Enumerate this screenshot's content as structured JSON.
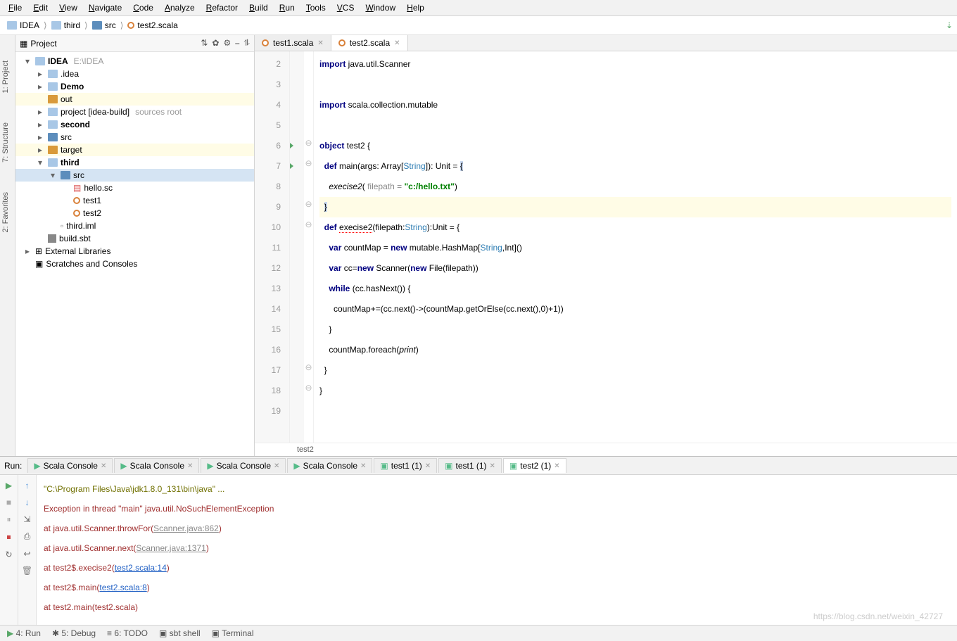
{
  "menu": [
    "File",
    "Edit",
    "View",
    "Navigate",
    "Code",
    "Analyze",
    "Refactor",
    "Build",
    "Run",
    "Tools",
    "VCS",
    "Window",
    "Help"
  ],
  "breadcrumbs": [
    {
      "icon": "idea",
      "label": "IDEA"
    },
    {
      "icon": "folder",
      "label": "third"
    },
    {
      "icon": "folder-blue",
      "label": "src"
    },
    {
      "icon": "scala",
      "label": "test2.scala"
    }
  ],
  "left_tabs": [
    "1: Project",
    "7: Structure",
    "2: Favorites"
  ],
  "project_panel": {
    "title": "Project",
    "tools": [
      "⇅",
      "✿",
      "⚙",
      "⎯",
      "⥮"
    ]
  },
  "tree": [
    {
      "d": 0,
      "tw": "▾",
      "ico": "idea",
      "label": "IDEA",
      "suffix": "E:\\IDEA",
      "bold": true
    },
    {
      "d": 1,
      "tw": "▸",
      "ico": "folder",
      "label": ".idea"
    },
    {
      "d": 1,
      "tw": "▸",
      "ico": "folder",
      "label": "Demo",
      "bold": true
    },
    {
      "d": 1,
      "tw": "",
      "ico": "folder-orange",
      "label": "out",
      "hl": true
    },
    {
      "d": 1,
      "tw": "▸",
      "ico": "folder",
      "label": "project [idea-build]",
      "suffix": "sources root"
    },
    {
      "d": 1,
      "tw": "▸",
      "ico": "folder",
      "label": "second",
      "bold": true
    },
    {
      "d": 1,
      "tw": "▸",
      "ico": "folder-blue",
      "label": "src"
    },
    {
      "d": 1,
      "tw": "▸",
      "ico": "folder-orange",
      "label": "target",
      "hl": true
    },
    {
      "d": 1,
      "tw": "▾",
      "ico": "folder",
      "label": "third",
      "bold": true
    },
    {
      "d": 2,
      "tw": "▾",
      "ico": "folder-blue",
      "label": "src",
      "sel": true
    },
    {
      "d": 3,
      "tw": "",
      "ico": "scala-file",
      "label": "hello.sc"
    },
    {
      "d": 3,
      "tw": "",
      "ico": "scala",
      "label": "test1"
    },
    {
      "d": 3,
      "tw": "",
      "ico": "scala",
      "label": "test2"
    },
    {
      "d": 2,
      "tw": "",
      "ico": "file",
      "label": "third.iml"
    },
    {
      "d": 1,
      "tw": "",
      "ico": "sbt",
      "label": "build.sbt"
    },
    {
      "d": 0,
      "tw": "▸",
      "ico": "lib",
      "label": "External Libraries"
    },
    {
      "d": 0,
      "tw": "",
      "ico": "scratch",
      "label": "Scratches and Consoles"
    }
  ],
  "editor_tabs": [
    {
      "label": "test1.scala",
      "active": false
    },
    {
      "label": "test2.scala",
      "active": true
    }
  ],
  "code_lines": [
    {
      "n": 2,
      "html": "<span class='kw'>import</span> java.util.Scanner"
    },
    {
      "n": 3,
      "html": ""
    },
    {
      "n": 4,
      "html": "<span class='kw'>import</span> scala.collection.mutable"
    },
    {
      "n": 5,
      "html": ""
    },
    {
      "n": 6,
      "run": true,
      "fold": "⊖",
      "html": "<span class='kw'>object</span> test2 {"
    },
    {
      "n": 7,
      "run": true,
      "fold": "⊖",
      "html": "  <span class='kw'>def</span> main(args: Array[<span class='ty'>String</span>]): Unit = <span class='sel-brace'>{</span>"
    },
    {
      "n": 8,
      "html": "    <span class='it'>execise2</span>( <span class='param'>filepath =</span> <span class='str'>\"c:/hello.txt\"</span>)"
    },
    {
      "n": 9,
      "hl": true,
      "fold": "⊖",
      "html": "  <span class='sel-brace'>}</span>"
    },
    {
      "n": 10,
      "fold": "⊖",
      "html": "  <span class='kw'>def</span> <span class='red-squig'>execise2</span>(filepath:<span class='ty'>String</span>):Unit = {"
    },
    {
      "n": 11,
      "html": "    <span class='kw'>var</span> countMap = <span class='kw'>new</span> mutable.HashMap[<span class='ty'>String</span>,Int]()"
    },
    {
      "n": 12,
      "html": "    <span class='kw'>var</span> cc=<span class='kw'>new</span> Scanner(<span class='kw'>new</span> File(filepath))"
    },
    {
      "n": 13,
      "html": "    <span class='kw'>while</span> (cc.hasNext()) {"
    },
    {
      "n": 14,
      "html": "      countMap+=(cc.next()-&gt;(countMap.getOrElse(cc.next(),0)+1))"
    },
    {
      "n": 15,
      "html": "    }"
    },
    {
      "n": 16,
      "html": "    countMap.foreach(<span class='it'>print</span>)"
    },
    {
      "n": 17,
      "fold": "⊖",
      "html": "  }"
    },
    {
      "n": 18,
      "fold": "⊖",
      "html": "}"
    },
    {
      "n": 19,
      "html": ""
    }
  ],
  "editor_crumb": "test2",
  "run": {
    "label": "Run:",
    "tabs": [
      {
        "label": "Scala Console",
        "ico": "sc"
      },
      {
        "label": "Scala Console",
        "ico": "sc"
      },
      {
        "label": "Scala Console",
        "ico": "sc"
      },
      {
        "label": "Scala Console",
        "ico": "sc"
      },
      {
        "label": "test1 (1)",
        "ico": "run"
      },
      {
        "label": "test1 (1)",
        "ico": "run"
      },
      {
        "label": "test2 (1)",
        "ico": "run",
        "active": true
      }
    ],
    "lines": [
      {
        "cls": "cmd",
        "text": "\"C:\\Program Files\\Java\\jdk1.8.0_131\\bin\\java\" ..."
      },
      {
        "cls": "err",
        "text": "Exception in thread \"main\" java.util.NoSuchElementException"
      },
      {
        "cls": "err",
        "pre": "    at java.util.Scanner.throwFor(",
        "link": "Scanner.java:862",
        "post": ")"
      },
      {
        "cls": "err",
        "pre": "    at java.util.Scanner.next(",
        "link": "Scanner.java:1371",
        "post": ")"
      },
      {
        "cls": "err",
        "pre": "    at test2$.execise2(",
        "link": "test2.scala:14",
        "post": ")",
        "blue": true
      },
      {
        "cls": "err",
        "pre": "    at test2$.main(",
        "link": "test2.scala:8",
        "post": ")",
        "blue": true
      },
      {
        "cls": "err",
        "text": "    at test2.main(test2.scala)"
      }
    ]
  },
  "status": [
    {
      "ico": "▶",
      "label": "4: Run",
      "green": true
    },
    {
      "ico": "✱",
      "label": "5: Debug"
    },
    {
      "ico": "≡",
      "label": "6: TODO"
    },
    {
      "ico": "▣",
      "label": "sbt shell"
    },
    {
      "ico": "▣",
      "label": "Terminal"
    }
  ],
  "watermark": "https://blog.csdn.net/weixin_42727"
}
